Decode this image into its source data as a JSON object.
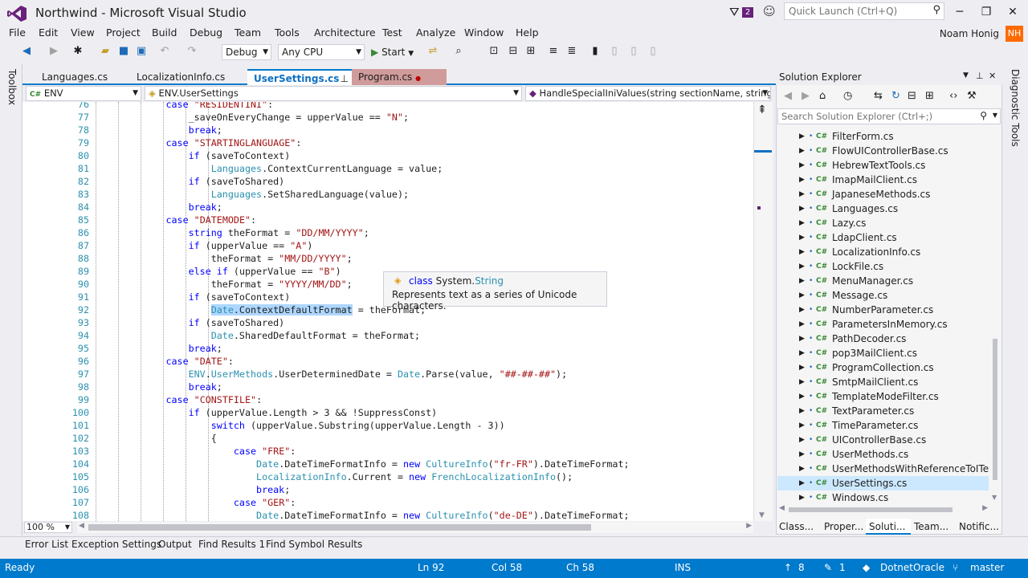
{
  "window": {
    "title": "Northwind - Microsoft Visual Studio",
    "notification_count": "2",
    "quick_launch_placeholder": "Quick Launch (Ctrl+Q)"
  },
  "menu": [
    "File",
    "Edit",
    "View",
    "Project",
    "Build",
    "Debug",
    "Team",
    "Tools",
    "Architecture",
    "Test",
    "Analyze",
    "Window",
    "Help"
  ],
  "user": {
    "name": "Noam Honig",
    "initials": "NH"
  },
  "toolbar": {
    "configuration": "Debug",
    "platform": "Any CPU",
    "start_label": "Start"
  },
  "toolbox_label": "Toolbox",
  "diagnostic_label": "Diagnostic Tools",
  "tabs": [
    {
      "label": "Languages.cs"
    },
    {
      "label": "LocalizationInfo.cs"
    },
    {
      "label": "UserSettings.cs",
      "active": true
    },
    {
      "label": "Program.cs"
    }
  ],
  "navbar": {
    "project": "ENV",
    "type": "ENV.UserSettings",
    "member": "HandleSpecialIniValues(string sectionName, string e"
  },
  "editor": {
    "zoom": "100 %",
    "lines": [
      {
        "n": "76",
        "text": "            case \"RESIDENTINI\":"
      },
      {
        "n": "77",
        "text": "                _saveOnEveryChange = upperValue == \"N\";"
      },
      {
        "n": "78",
        "text": "                break;"
      },
      {
        "n": "79",
        "text": "            case \"STARTINGLANGUAGE\":"
      },
      {
        "n": "80",
        "text": "                if (saveToContext)"
      },
      {
        "n": "81",
        "text": "                    Languages.ContextCurrentLanguage = value;"
      },
      {
        "n": "82",
        "text": "                if (saveToShared)"
      },
      {
        "n": "83",
        "text": "                    Languages.SetSharedLanguage(value);"
      },
      {
        "n": "84",
        "text": "                break;"
      },
      {
        "n": "85",
        "text": "            case \"DATEMODE\":"
      },
      {
        "n": "86",
        "text": "                string theFormat = \"DD/MM/YYYY\";"
      },
      {
        "n": "87",
        "text": "                if (upperValue == \"A\")"
      },
      {
        "n": "88",
        "text": "                    theFormat = \"MM/DD/YYYY\";"
      },
      {
        "n": "89",
        "text": "                else if (upperValue == \"B\")"
      },
      {
        "n": "90",
        "text": "                    theFormat = \"YYYY/MM/DD\";"
      },
      {
        "n": "91",
        "text": "                if (saveToContext)"
      },
      {
        "n": "92",
        "text": "                    Date.ContextDefaultFormat = theFormat;"
      },
      {
        "n": "93",
        "text": "                if (saveToShared)"
      },
      {
        "n": "94",
        "text": "                    Date.SharedDefaultFormat = theFormat;"
      },
      {
        "n": "95",
        "text": "                break;"
      },
      {
        "n": "96",
        "text": "            case \"DATE\":"
      },
      {
        "n": "97",
        "text": "                ENV.UserMethods.UserDeterminedDate = Date.Parse(value, \"##-##-##\");"
      },
      {
        "n": "98",
        "text": "                break;"
      },
      {
        "n": "99",
        "text": "            case \"CONSTFILE\":"
      },
      {
        "n": "100",
        "text": "                if (upperValue.Length > 3 && !SuppressConst)"
      },
      {
        "n": "101",
        "text": "                    switch (upperValue.Substring(upperValue.Length - 3))"
      },
      {
        "n": "102",
        "text": "                    {"
      },
      {
        "n": "103",
        "text": "                        case \"FRE\":"
      },
      {
        "n": "104",
        "text": "                            Date.DateTimeFormatInfo = new CultureInfo(\"fr-FR\").DateTimeFormat;"
      },
      {
        "n": "105",
        "text": "                            LocalizationInfo.Current = new FrenchLocalizationInfo();"
      },
      {
        "n": "106",
        "text": "                            break;"
      },
      {
        "n": "107",
        "text": "                        case \"GER\":"
      },
      {
        "n": "108",
        "text": "                            Date.DateTimeFormatInfo = new CultureInfo(\"de-DE\").DateTimeFormat;"
      }
    ]
  },
  "tooltip": {
    "kind": "class",
    "ns": "System.",
    "type": "String",
    "description": "Represents text as a series of Unicode characters."
  },
  "solution_explorer": {
    "title": "Solution Explorer",
    "search_placeholder": "Search Solution Explorer (Ctrl+;)",
    "file_badge": "C#",
    "items": [
      "FilterForm.cs",
      "FlowUIControllerBase.cs",
      "HebrewTextTools.cs",
      "ImapMailClient.cs",
      "JapaneseMethods.cs",
      "Languages.cs",
      "Lazy.cs",
      "LdapClient.cs",
      "LocalizationInfo.cs",
      "LockFile.cs",
      "MenuManager.cs",
      "Message.cs",
      "NumberParameter.cs",
      "ParametersInMemory.cs",
      "PathDecoder.cs",
      "pop3MailClient.cs",
      "ProgramCollection.cs",
      "SmtpMailClient.cs",
      "TemplateModeFilter.cs",
      "TextParameter.cs",
      "TimeParameter.cs",
      "UIControllerBase.cs",
      "UserMethods.cs",
      "UserMethodsWithReferenceToITextS",
      "UserSettings.cs",
      "Windows.cs"
    ],
    "selected": "UserSettings.cs",
    "bottom_tabs": [
      "Class...",
      "Proper...",
      "Soluti...",
      "Team...",
      "Notific..."
    ]
  },
  "output_tabs": [
    "Error List",
    "Exception Settings",
    "Output",
    "Find Results 1",
    "Find Symbol Results"
  ],
  "status": {
    "state": "Ready",
    "ln": "Ln 92",
    "col": "Col 58",
    "ch": "Ch 58",
    "mode": "INS",
    "pending_up": "8",
    "pending_edits": "1",
    "repo": "DotnetOracle",
    "branch": "master"
  },
  "colors": {
    "accent": "#007acc",
    "vs_purple": "#68217a",
    "keyword": "#0000ff",
    "string": "#a31515",
    "type": "#2b91af"
  }
}
